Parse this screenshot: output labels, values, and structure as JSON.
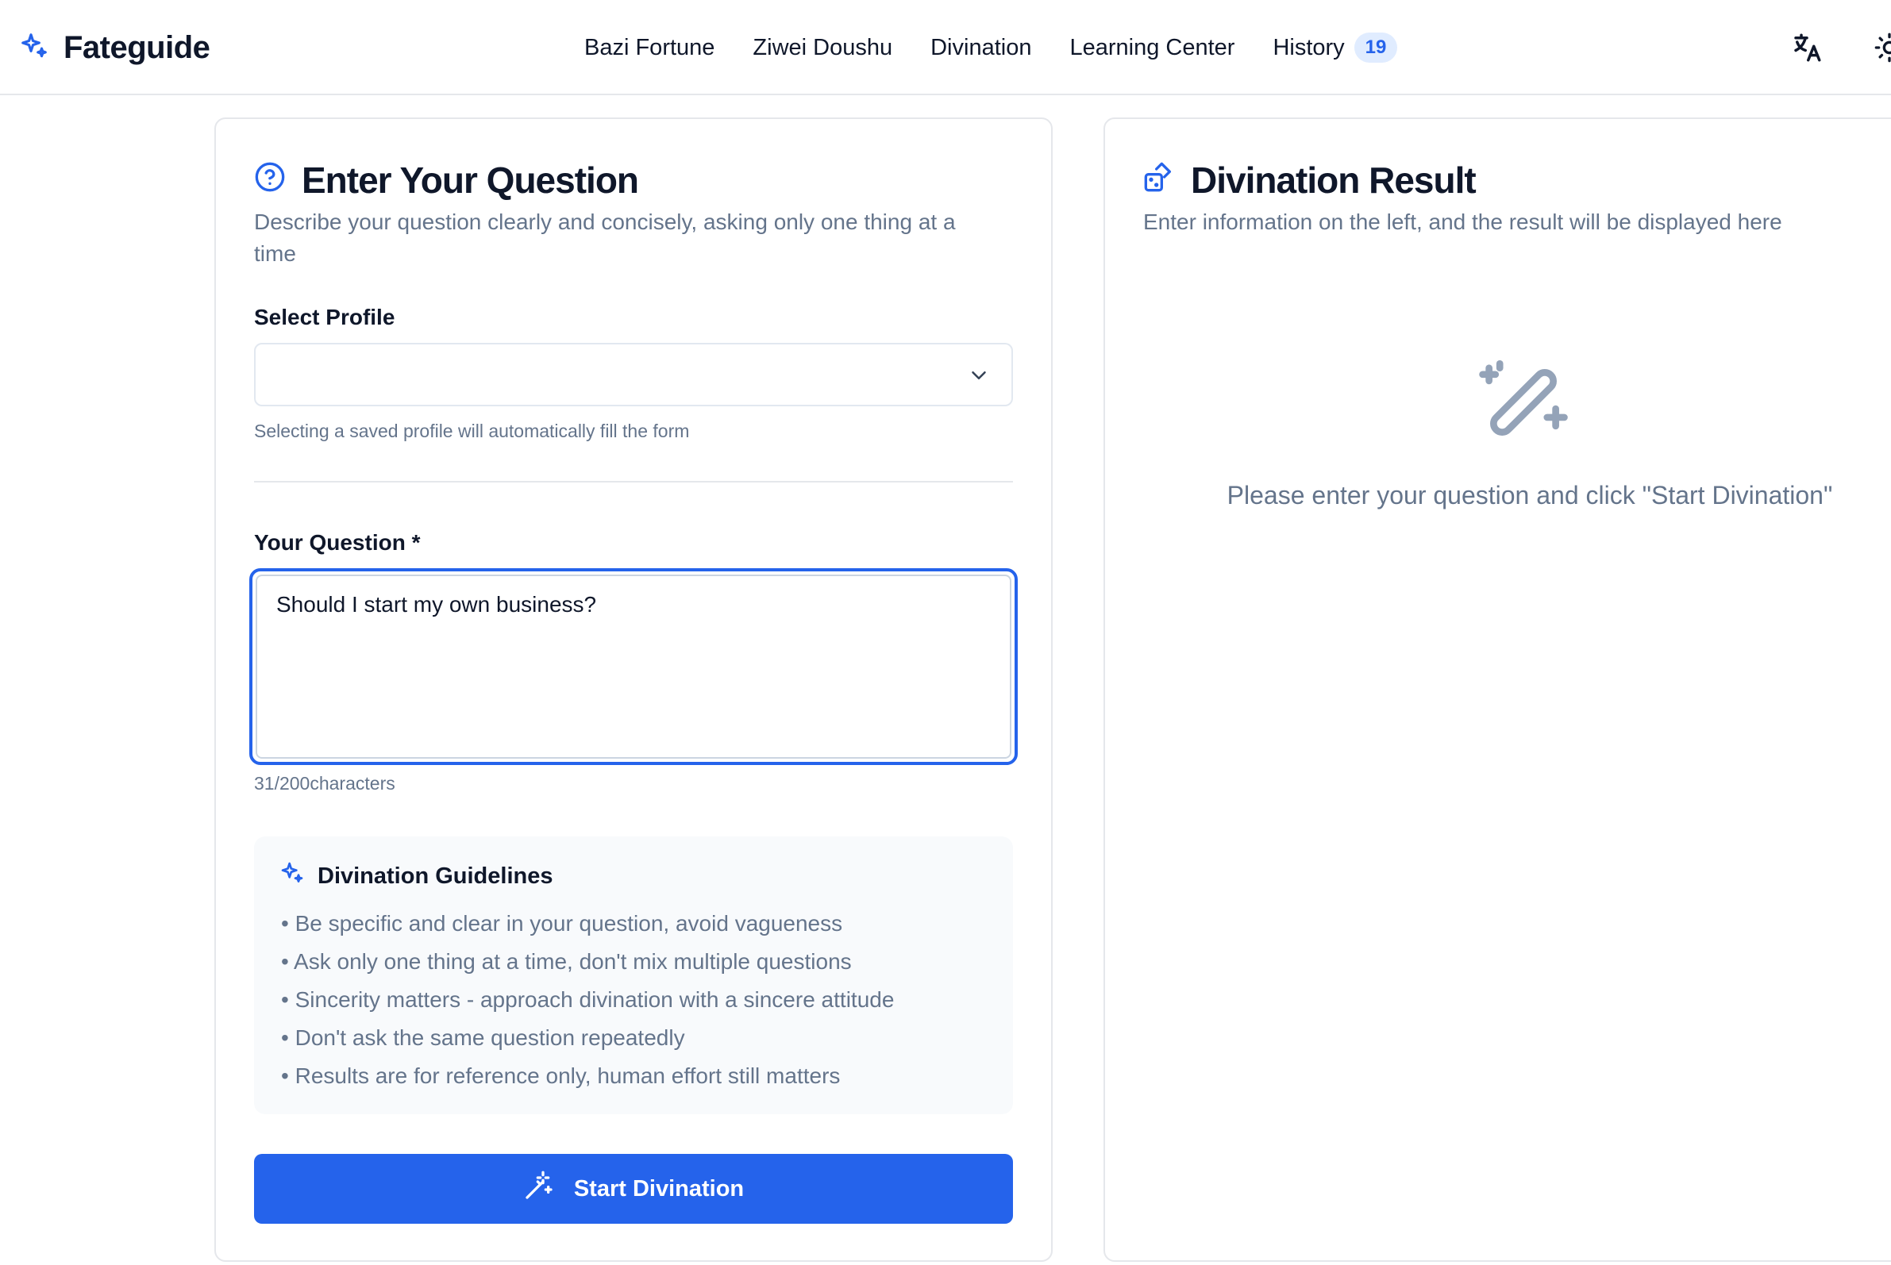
{
  "brand": {
    "name": "Fateguide",
    "accent": "#2563eb"
  },
  "nav": {
    "items": [
      {
        "label": "Bazi Fortune"
      },
      {
        "label": "Ziwei Doushu"
      },
      {
        "label": "Divination"
      },
      {
        "label": "Learning Center"
      },
      {
        "label": "History",
        "badge": "19"
      }
    ]
  },
  "header_icons": [
    "translate-icon",
    "sun-icon"
  ],
  "question_card": {
    "title": "Enter Your Question",
    "subtitle": "Describe your question clearly and concisely, asking only one thing at a time",
    "profile_label": "Select Profile",
    "profile_value": "",
    "profile_hint": "Selecting a saved profile will automatically fill the form",
    "question_label": "Your Question *",
    "question_value": "Should I start my own business?",
    "counter": "31/200characters",
    "guidelines": {
      "title": "Divination Guidelines",
      "items": [
        "Be specific and clear in your question, avoid vagueness",
        "Ask only one thing at a time, don't mix multiple questions",
        "Sincerity matters - approach divination with a sincere attitude",
        "Don't ask the same question repeatedly",
        "Results are for reference only, human effort still matters"
      ]
    },
    "submit_label": "Start Divination"
  },
  "result_card": {
    "title": "Divination Result",
    "subtitle": "Enter information on the left, and the result will be displayed here",
    "empty_text": "Please enter your question and click \"Start Divination\""
  }
}
